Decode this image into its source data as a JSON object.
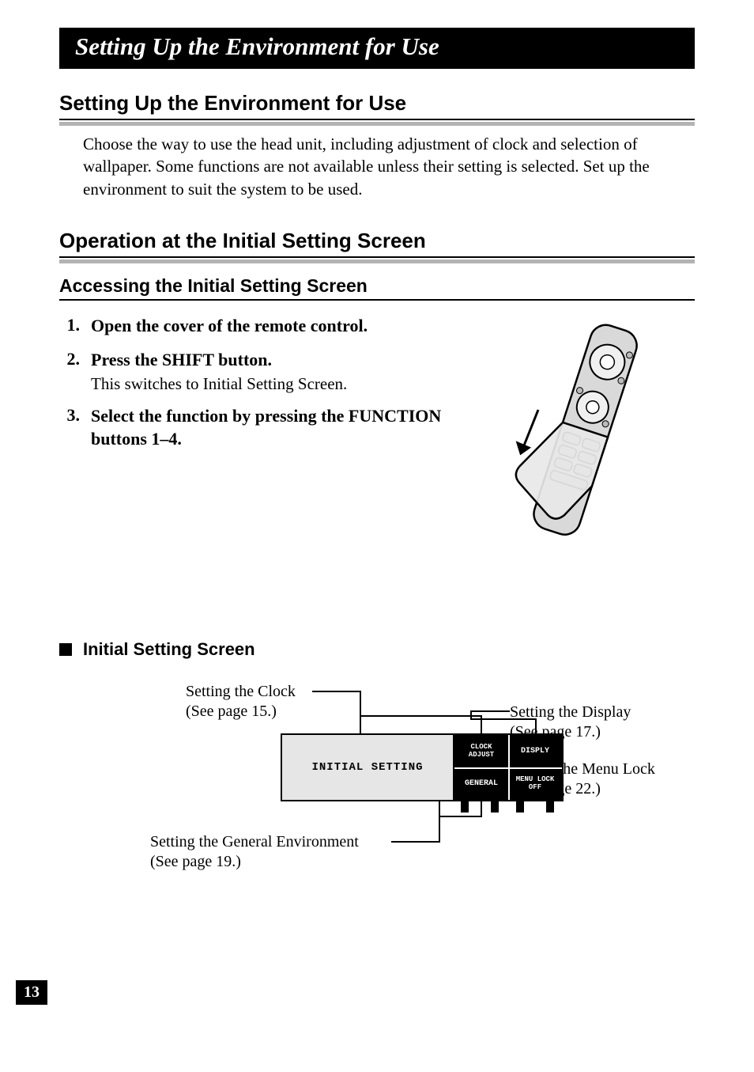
{
  "banner": "Setting Up the Environment for Use",
  "h1": "Setting Up the Environment for Use",
  "intro": "Choose the way to use the head unit, including adjustment of clock and selection of wallpaper. Some functions are not available unless their setting is selected. Set up the environment to suit the system to be used.",
  "h2": "Operation at the Initial Setting Screen",
  "h3": "Accessing the Initial Setting Screen",
  "steps": [
    {
      "num": "1.",
      "title": "Open the cover of the remote control.",
      "desc": ""
    },
    {
      "num": "2.",
      "title": "Press the SHIFT button.",
      "desc": "This switches to Initial Setting Screen."
    },
    {
      "num": "3.",
      "title": "Select the function by pressing the FUNCTION buttons 1–4.",
      "desc": ""
    }
  ],
  "bulletLabel": "Initial Setting Screen",
  "callouts": {
    "clock_l1": "Setting the Clock",
    "clock_l2": "(See page 15.)",
    "display_l1": "Setting the Display",
    "display_l2": "(See page 17.)",
    "menulock_l1": "Setting the Menu Lock",
    "menulock_l2": "(See page 22.)",
    "general_l1": "Setting the General Environment",
    "general_l2": "(See page 19.)"
  },
  "screen": {
    "left": "INITIAL SETTING",
    "cells": {
      "tl_l1": "CLOCK",
      "tl_l2": "ADJUST",
      "tr": "DISPLY",
      "bl": "GENERAL",
      "br_l1": "MENU LOCK",
      "br_l2": "OFF"
    }
  },
  "pageNumber": "13"
}
